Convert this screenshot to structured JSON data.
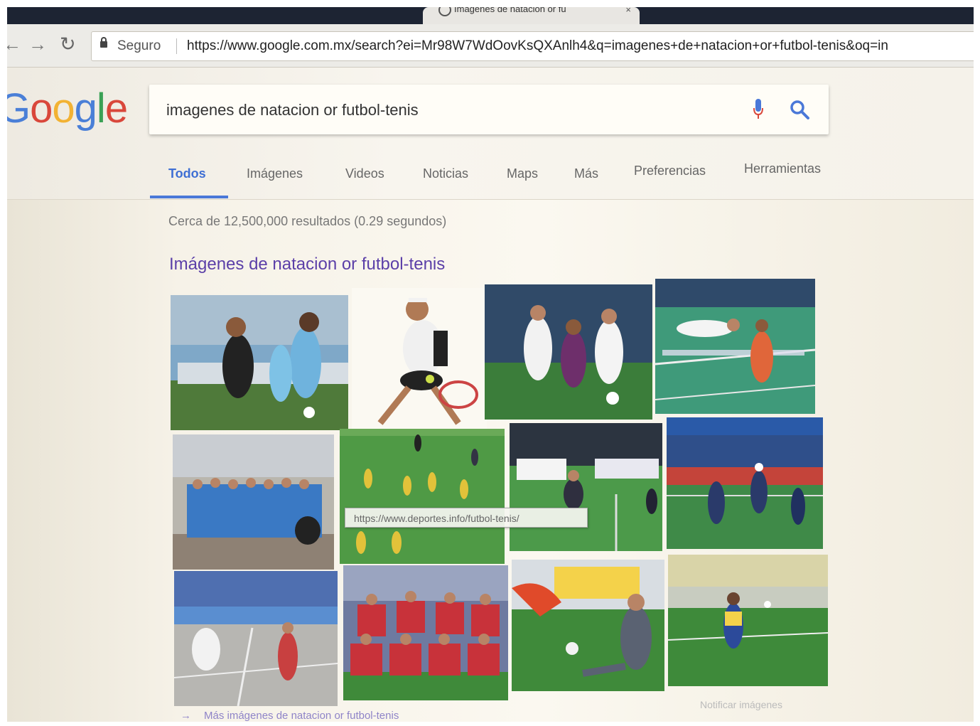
{
  "browser": {
    "tab_title": "Imágenes de natacion or fu",
    "secure_label": "Seguro",
    "url": "https://www.google.com.mx/search?ei=Mr98W7WdOovKsQXAnlh4&q=imagenes+de+natacion+or+futbol-tenis&oq=in"
  },
  "google": {
    "logo_letters": [
      "G",
      "o",
      "o",
      "g",
      "l",
      "e"
    ],
    "logo_colors": [
      "#4a7fd7",
      "#d9473b",
      "#f2b233",
      "#4a7fd7",
      "#3aa155",
      "#d9473b"
    ],
    "query": "imagenes de natacion or futbol-tenis",
    "icons": {
      "mic": "mic-icon",
      "search": "search-icon"
    }
  },
  "tabs": [
    {
      "label": "Todos",
      "active": true
    },
    {
      "label": "Imágenes"
    },
    {
      "label": "Videos"
    },
    {
      "label": "Noticias"
    },
    {
      "label": "Maps"
    },
    {
      "label": "Más"
    },
    {
      "label": "Preferencias"
    },
    {
      "label": "Herramientas"
    }
  ],
  "results": {
    "stats": "Cerca de 12,500,000 resultados (0.29 segundos)",
    "images_heading": "Imágenes de natacion or futbol-tenis",
    "tooltip_url": "https://www.deportes.info/futbol-tenis/",
    "more_link": "Más imágenes de natacion or futbol-tenis",
    "report_link": "Notificar imágenes"
  },
  "colors": {
    "accent_blue": "#4a78d8",
    "heading_purple": "#5b3fa8",
    "field_green": "#3e8a3a"
  }
}
